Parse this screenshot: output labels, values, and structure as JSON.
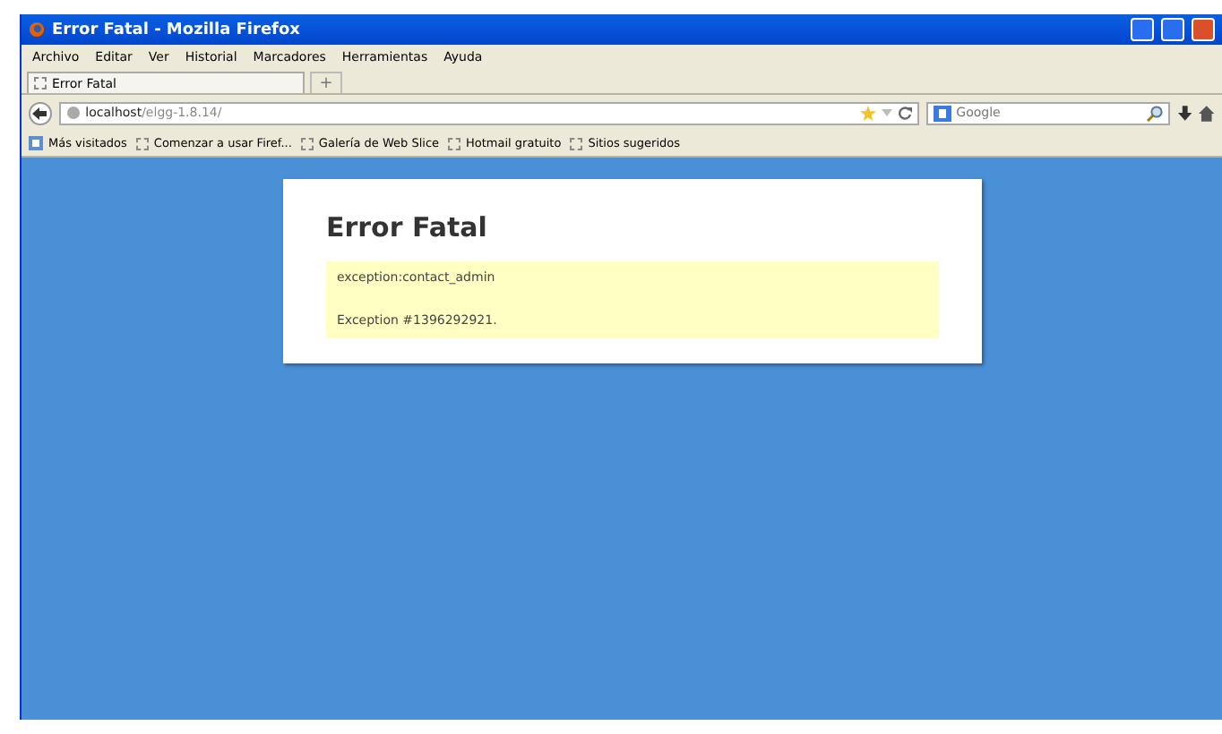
{
  "window": {
    "title": "Error Fatal - Mozilla Firefox"
  },
  "menu": [
    "Archivo",
    "Editar",
    "Ver",
    "Historial",
    "Marcadores",
    "Herramientas",
    "Ayuda"
  ],
  "tabs": [
    {
      "label": "Error Fatal",
      "selected": true
    }
  ],
  "new_tab": "+",
  "address": {
    "host": "localhost",
    "path": "/elgg-1.8.14/"
  },
  "search": {
    "placeholder": "Google"
  },
  "bookmarks": [
    {
      "label": "Más visitados",
      "kind": "special"
    },
    {
      "label": "Comenzar a usar Firef...",
      "kind": "page"
    },
    {
      "label": "Galería de Web Slice",
      "kind": "page"
    },
    {
      "label": "Hotmail gratuito",
      "kind": "page"
    },
    {
      "label": "Sitios sugeridos",
      "kind": "page"
    }
  ],
  "page": {
    "heading": "Error Fatal",
    "messages": [
      "exception:contact_admin",
      "Exception #1396292921."
    ]
  }
}
